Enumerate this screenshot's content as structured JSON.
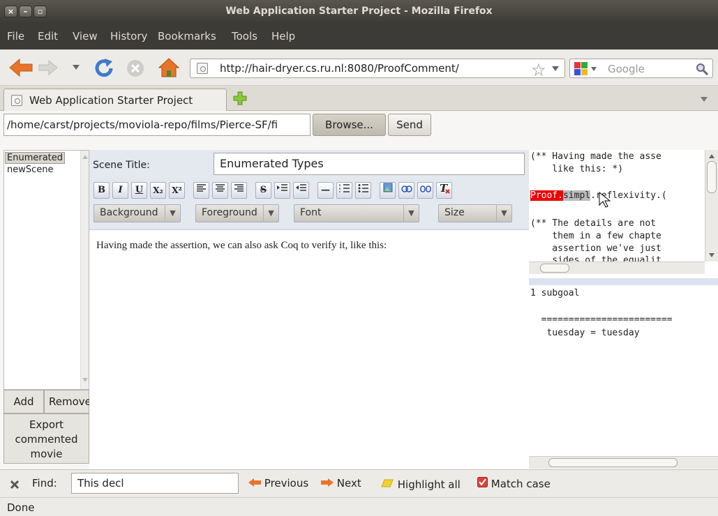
{
  "window": {
    "title": "Web Application Starter Project - Mozilla Firefox",
    "close_glyph": "×",
    "minimize_glyph": "–",
    "maximize_glyph": "▫"
  },
  "menu": [
    "File",
    "Edit",
    "View",
    "History",
    "Bookmarks",
    "Tools",
    "Help"
  ],
  "nav": {
    "url": "http://hair-dryer.cs.ru.nl:8080/ProofComment/",
    "search_placeholder": "Google"
  },
  "tab": {
    "label": "Web Application Starter Project"
  },
  "upload": {
    "path": "/home/carst/projects/moviola-repo/films/Pierce-SF/fi",
    "browse_label": "Browse...",
    "send_label": "Send"
  },
  "scenes": {
    "items": [
      "Enumerated",
      "newScene"
    ],
    "selected": "Enumerated"
  },
  "list_buttons": {
    "add": "Add",
    "remove": "Remove",
    "export_line1": "Export",
    "export_line2": "commented",
    "export_line3": "movie"
  },
  "editor": {
    "scene_title_label": "Scene Title:",
    "scene_title_value": "Enumerated Types",
    "format_buttons": {
      "bold": "B",
      "italic": "I",
      "underline": "U",
      "subscript": "X₂",
      "superscript": "X²",
      "strike": "S",
      "rule": "—"
    },
    "selects": {
      "background": "Background",
      "foreground": "Foreground",
      "font": "Font",
      "size": "Size"
    },
    "body_text": "Having made the assertion, we can also ask Coq to verify it, like this:"
  },
  "code": {
    "line1": "(** Having made the asse",
    "line2": "    like this: *)",
    "proof": "Proof.",
    "simpl": "simpl",
    "rest": ".reflexivity.(",
    "line4": "(** The details are not ",
    "line5": "    them in a few chapte",
    "line6": "    assertion we've just",
    "line7": "    sides of the equalit",
    "goal_count": "1 subgoal",
    "goal_sep": "  ========================",
    "goal": "   tuesday = tuesday"
  },
  "find": {
    "label": "Find:",
    "value": "This decl",
    "previous": "Previous",
    "next": "Next",
    "highlight": "Highlight all",
    "match_case": "Match case",
    "match_case_checked": true
  },
  "status": "Done",
  "colors": {
    "menubar": "#3c3b37",
    "accent_orange": "#e8742a",
    "highlight_red": "#e00000"
  }
}
